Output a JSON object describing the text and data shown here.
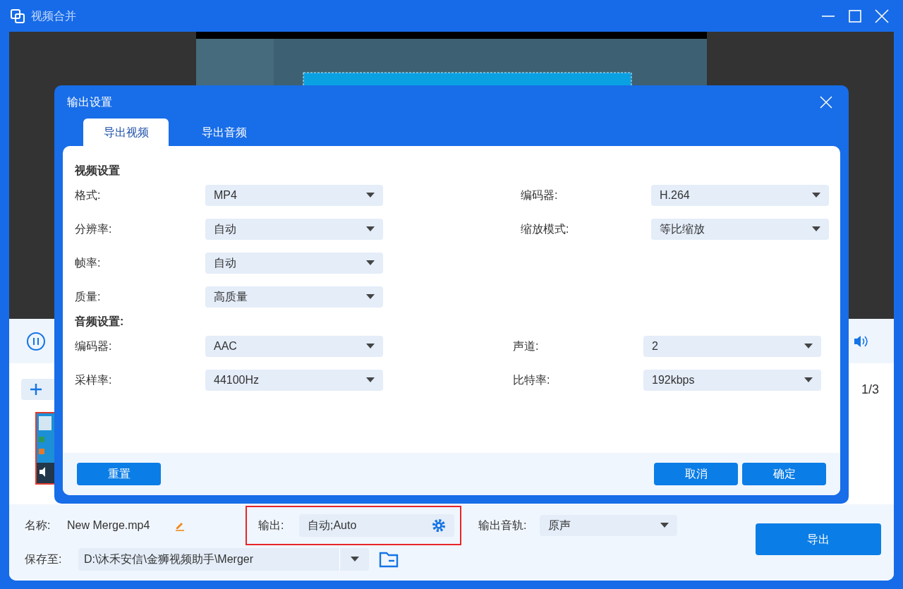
{
  "window": {
    "title": "视频合并"
  },
  "player": {
    "counter": "1/3"
  },
  "bottom": {
    "name_label": "名称:",
    "name_value": "New Merge.mp4",
    "output_label": "输出:",
    "output_value": "自动;Auto",
    "track_label": "输出音轨:",
    "track_value": "原声",
    "save_label": "保存至:",
    "save_path": "D:\\沐禾安信\\金狮视频助手\\Merger",
    "export_button": "导出"
  },
  "dialog": {
    "title": "输出设置",
    "tabs": [
      {
        "label": "导出视频",
        "selected": true
      },
      {
        "label": "导出音频",
        "selected": false
      }
    ],
    "sections": [
      {
        "title": "视频设置",
        "rows": [
          [
            {
              "label": "格式:",
              "value": "MP4"
            },
            {
              "label": "编码器:",
              "value": "H.264"
            }
          ],
          [
            {
              "label": "分辨率:",
              "value": "自动"
            },
            {
              "label": "缩放模式:",
              "value": "等比缩放"
            }
          ],
          [
            {
              "label": "帧率:",
              "value": "自动"
            }
          ],
          [
            {
              "label": "质量:",
              "value": "高质量"
            }
          ]
        ]
      },
      {
        "title": "音频设置:",
        "rows": [
          [
            {
              "label": "编码器:",
              "value": "AAC"
            },
            {
              "label": "声道:",
              "value": "2"
            }
          ],
          [
            {
              "label": "采样率:",
              "value": "44100Hz"
            },
            {
              "label": "比特率:",
              "value": "192kbps"
            }
          ]
        ]
      }
    ],
    "buttons": {
      "reset": "重置",
      "cancel": "取消",
      "ok": "确定"
    }
  }
}
